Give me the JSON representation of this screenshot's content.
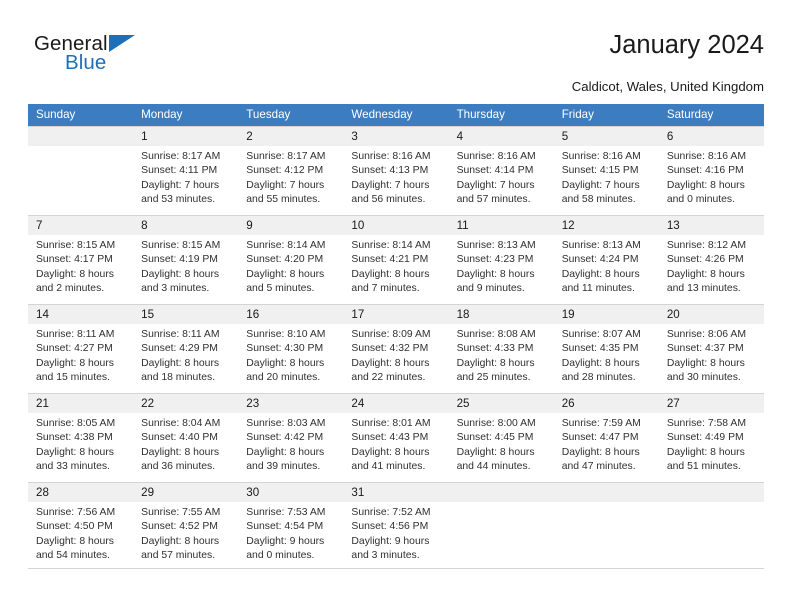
{
  "brand": {
    "name_part1": "General",
    "name_part2": "Blue",
    "accent_color": "#1d6fb8"
  },
  "header": {
    "title": "January 2024",
    "subtitle": "Caldicot, Wales, United Kingdom"
  },
  "calendar": {
    "header_color": "#3b7dc0",
    "daynum_band_color": "#f0f0f0",
    "weekdays": [
      "Sunday",
      "Monday",
      "Tuesday",
      "Wednesday",
      "Thursday",
      "Friday",
      "Saturday"
    ],
    "weeks": [
      [
        {
          "day": "",
          "empty": true
        },
        {
          "day": "1",
          "sunrise": "Sunrise: 8:17 AM",
          "sunset": "Sunset: 4:11 PM",
          "daylight1": "Daylight: 7 hours",
          "daylight2": "and 53 minutes."
        },
        {
          "day": "2",
          "sunrise": "Sunrise: 8:17 AM",
          "sunset": "Sunset: 4:12 PM",
          "daylight1": "Daylight: 7 hours",
          "daylight2": "and 55 minutes."
        },
        {
          "day": "3",
          "sunrise": "Sunrise: 8:16 AM",
          "sunset": "Sunset: 4:13 PM",
          "daylight1": "Daylight: 7 hours",
          "daylight2": "and 56 minutes."
        },
        {
          "day": "4",
          "sunrise": "Sunrise: 8:16 AM",
          "sunset": "Sunset: 4:14 PM",
          "daylight1": "Daylight: 7 hours",
          "daylight2": "and 57 minutes."
        },
        {
          "day": "5",
          "sunrise": "Sunrise: 8:16 AM",
          "sunset": "Sunset: 4:15 PM",
          "daylight1": "Daylight: 7 hours",
          "daylight2": "and 58 minutes."
        },
        {
          "day": "6",
          "sunrise": "Sunrise: 8:16 AM",
          "sunset": "Sunset: 4:16 PM",
          "daylight1": "Daylight: 8 hours",
          "daylight2": "and 0 minutes."
        }
      ],
      [
        {
          "day": "7",
          "sunrise": "Sunrise: 8:15 AM",
          "sunset": "Sunset: 4:17 PM",
          "daylight1": "Daylight: 8 hours",
          "daylight2": "and 2 minutes."
        },
        {
          "day": "8",
          "sunrise": "Sunrise: 8:15 AM",
          "sunset": "Sunset: 4:19 PM",
          "daylight1": "Daylight: 8 hours",
          "daylight2": "and 3 minutes."
        },
        {
          "day": "9",
          "sunrise": "Sunrise: 8:14 AM",
          "sunset": "Sunset: 4:20 PM",
          "daylight1": "Daylight: 8 hours",
          "daylight2": "and 5 minutes."
        },
        {
          "day": "10",
          "sunrise": "Sunrise: 8:14 AM",
          "sunset": "Sunset: 4:21 PM",
          "daylight1": "Daylight: 8 hours",
          "daylight2": "and 7 minutes."
        },
        {
          "day": "11",
          "sunrise": "Sunrise: 8:13 AM",
          "sunset": "Sunset: 4:23 PM",
          "daylight1": "Daylight: 8 hours",
          "daylight2": "and 9 minutes."
        },
        {
          "day": "12",
          "sunrise": "Sunrise: 8:13 AM",
          "sunset": "Sunset: 4:24 PM",
          "daylight1": "Daylight: 8 hours",
          "daylight2": "and 11 minutes."
        },
        {
          "day": "13",
          "sunrise": "Sunrise: 8:12 AM",
          "sunset": "Sunset: 4:26 PM",
          "daylight1": "Daylight: 8 hours",
          "daylight2": "and 13 minutes."
        }
      ],
      [
        {
          "day": "14",
          "sunrise": "Sunrise: 8:11 AM",
          "sunset": "Sunset: 4:27 PM",
          "daylight1": "Daylight: 8 hours",
          "daylight2": "and 15 minutes."
        },
        {
          "day": "15",
          "sunrise": "Sunrise: 8:11 AM",
          "sunset": "Sunset: 4:29 PM",
          "daylight1": "Daylight: 8 hours",
          "daylight2": "and 18 minutes."
        },
        {
          "day": "16",
          "sunrise": "Sunrise: 8:10 AM",
          "sunset": "Sunset: 4:30 PM",
          "daylight1": "Daylight: 8 hours",
          "daylight2": "and 20 minutes."
        },
        {
          "day": "17",
          "sunrise": "Sunrise: 8:09 AM",
          "sunset": "Sunset: 4:32 PM",
          "daylight1": "Daylight: 8 hours",
          "daylight2": "and 22 minutes."
        },
        {
          "day": "18",
          "sunrise": "Sunrise: 8:08 AM",
          "sunset": "Sunset: 4:33 PM",
          "daylight1": "Daylight: 8 hours",
          "daylight2": "and 25 minutes."
        },
        {
          "day": "19",
          "sunrise": "Sunrise: 8:07 AM",
          "sunset": "Sunset: 4:35 PM",
          "daylight1": "Daylight: 8 hours",
          "daylight2": "and 28 minutes."
        },
        {
          "day": "20",
          "sunrise": "Sunrise: 8:06 AM",
          "sunset": "Sunset: 4:37 PM",
          "daylight1": "Daylight: 8 hours",
          "daylight2": "and 30 minutes."
        }
      ],
      [
        {
          "day": "21",
          "sunrise": "Sunrise: 8:05 AM",
          "sunset": "Sunset: 4:38 PM",
          "daylight1": "Daylight: 8 hours",
          "daylight2": "and 33 minutes."
        },
        {
          "day": "22",
          "sunrise": "Sunrise: 8:04 AM",
          "sunset": "Sunset: 4:40 PM",
          "daylight1": "Daylight: 8 hours",
          "daylight2": "and 36 minutes."
        },
        {
          "day": "23",
          "sunrise": "Sunrise: 8:03 AM",
          "sunset": "Sunset: 4:42 PM",
          "daylight1": "Daylight: 8 hours",
          "daylight2": "and 39 minutes."
        },
        {
          "day": "24",
          "sunrise": "Sunrise: 8:01 AM",
          "sunset": "Sunset: 4:43 PM",
          "daylight1": "Daylight: 8 hours",
          "daylight2": "and 41 minutes."
        },
        {
          "day": "25",
          "sunrise": "Sunrise: 8:00 AM",
          "sunset": "Sunset: 4:45 PM",
          "daylight1": "Daylight: 8 hours",
          "daylight2": "and 44 minutes."
        },
        {
          "day": "26",
          "sunrise": "Sunrise: 7:59 AM",
          "sunset": "Sunset: 4:47 PM",
          "daylight1": "Daylight: 8 hours",
          "daylight2": "and 47 minutes."
        },
        {
          "day": "27",
          "sunrise": "Sunrise: 7:58 AM",
          "sunset": "Sunset: 4:49 PM",
          "daylight1": "Daylight: 8 hours",
          "daylight2": "and 51 minutes."
        }
      ],
      [
        {
          "day": "28",
          "sunrise": "Sunrise: 7:56 AM",
          "sunset": "Sunset: 4:50 PM",
          "daylight1": "Daylight: 8 hours",
          "daylight2": "and 54 minutes."
        },
        {
          "day": "29",
          "sunrise": "Sunrise: 7:55 AM",
          "sunset": "Sunset: 4:52 PM",
          "daylight1": "Daylight: 8 hours",
          "daylight2": "and 57 minutes."
        },
        {
          "day": "30",
          "sunrise": "Sunrise: 7:53 AM",
          "sunset": "Sunset: 4:54 PM",
          "daylight1": "Daylight: 9 hours",
          "daylight2": "and 0 minutes."
        },
        {
          "day": "31",
          "sunrise": "Sunrise: 7:52 AM",
          "sunset": "Sunset: 4:56 PM",
          "daylight1": "Daylight: 9 hours",
          "daylight2": "and 3 minutes."
        },
        {
          "day": "",
          "empty": true
        },
        {
          "day": "",
          "empty": true
        },
        {
          "day": "",
          "empty": true
        }
      ]
    ]
  }
}
